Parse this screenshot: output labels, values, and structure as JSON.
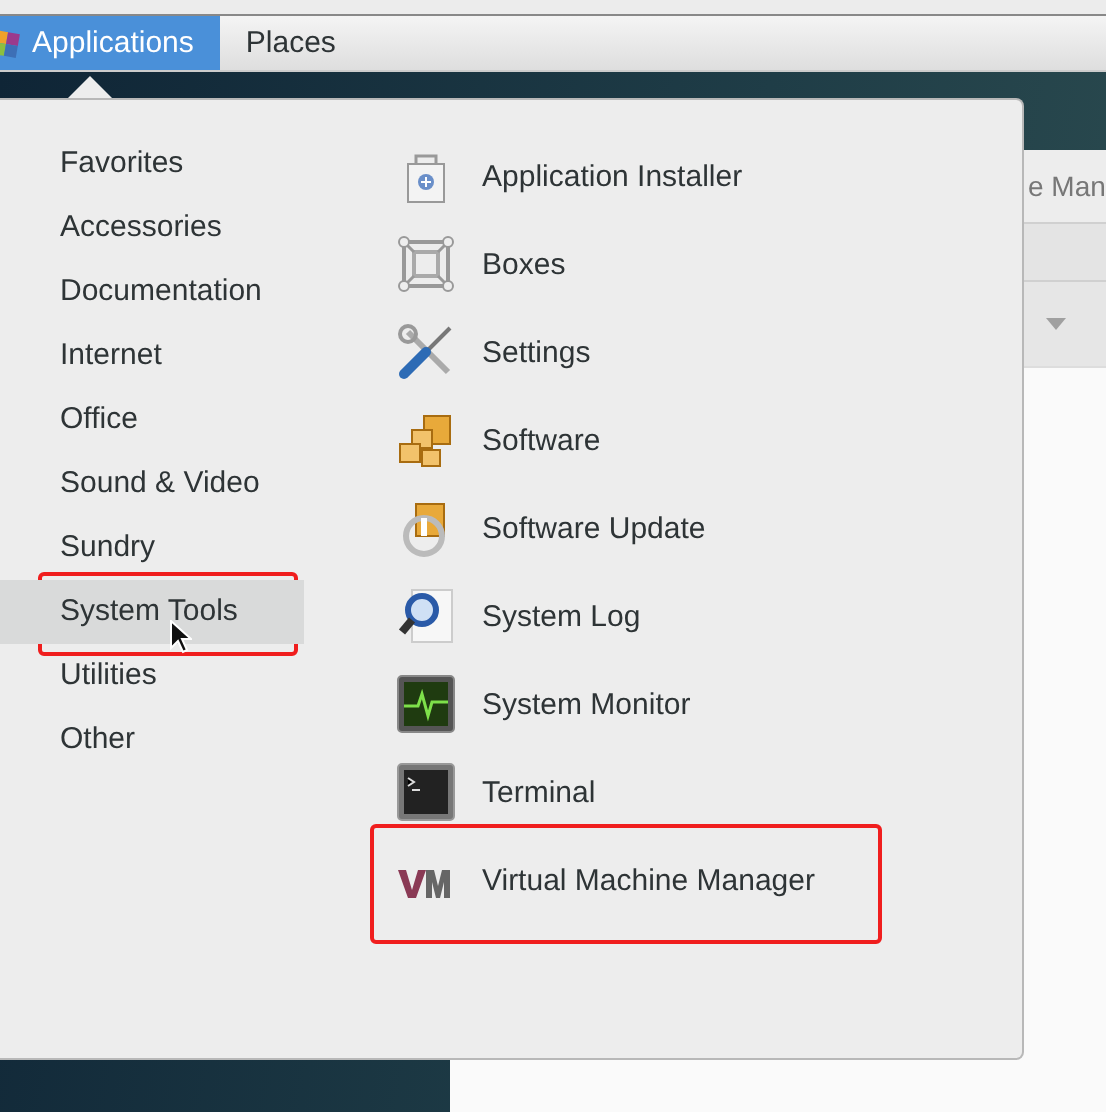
{
  "top_bar": {
    "menus": [
      {
        "label": "Applications",
        "selected": true
      },
      {
        "label": "Places",
        "selected": false
      }
    ]
  },
  "background_window": {
    "title": "e Man"
  },
  "menu": {
    "categories": [
      {
        "label": "Favorites",
        "selected": false,
        "annotated": false
      },
      {
        "label": "Accessories",
        "selected": false,
        "annotated": false
      },
      {
        "label": "Documentation",
        "selected": false,
        "annotated": false
      },
      {
        "label": "Internet",
        "selected": false,
        "annotated": false
      },
      {
        "label": "Office",
        "selected": false,
        "annotated": false
      },
      {
        "label": "Sound & Video",
        "selected": false,
        "annotated": false
      },
      {
        "label": "Sundry",
        "selected": false,
        "annotated": false
      },
      {
        "label": "System Tools",
        "selected": true,
        "annotated": true
      },
      {
        "label": "Utilities",
        "selected": false,
        "annotated": false
      },
      {
        "label": "Other",
        "selected": false,
        "annotated": false
      }
    ],
    "apps": [
      {
        "label": "Application Installer",
        "annotated": false
      },
      {
        "label": "Boxes",
        "annotated": false
      },
      {
        "label": "Settings",
        "annotated": false
      },
      {
        "label": "Software",
        "annotated": false
      },
      {
        "label": "Software Update",
        "annotated": false
      },
      {
        "label": "System Log",
        "annotated": false
      },
      {
        "label": "System Monitor",
        "annotated": false
      },
      {
        "label": "Terminal",
        "annotated": false
      },
      {
        "label": "Virtual Machine Manager",
        "annotated": true
      }
    ]
  }
}
